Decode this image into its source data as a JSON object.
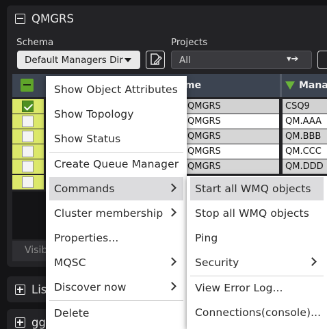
{
  "panel": {
    "title": "QMGRS"
  },
  "schema": {
    "label": "Schema",
    "value": "Default Managers Dir"
  },
  "projects": {
    "label": "Projects",
    "value": "All"
  },
  "table": {
    "columns": [
      "me",
      "Mana"
    ],
    "rows": [
      {
        "checked": true,
        "name": "QMGRS",
        "manager": "CSQ9"
      },
      {
        "checked": false,
        "name": "QMGRS",
        "manager": "QM.AAA"
      },
      {
        "checked": false,
        "name": "QMGRS",
        "manager": "QM.BBB"
      },
      {
        "checked": false,
        "name": "QMGRS",
        "manager": "QM.CCC"
      },
      {
        "checked": false,
        "name": "QMGRS",
        "manager": "QM.DDD"
      },
      {
        "checked": false,
        "name": "",
        "manager": ""
      }
    ],
    "footer": "Visib"
  },
  "lower_panels": [
    "Lis",
    "gg"
  ],
  "context_menu": {
    "items": [
      {
        "label": "Show Object Attributes",
        "submenu": false
      },
      {
        "label": "Show Topology",
        "submenu": false
      },
      {
        "label": "Show Status",
        "submenu": false
      },
      {
        "label": "Create Queue Manager",
        "submenu": false
      },
      {
        "label": "Commands",
        "submenu": true,
        "highlighted": true
      },
      {
        "label": "Cluster membership",
        "submenu": true
      },
      {
        "label": "Properties...",
        "submenu": false
      },
      {
        "label": "MQSC",
        "submenu": true
      },
      {
        "label": "Discover now",
        "submenu": true
      },
      {
        "label": "Delete",
        "submenu": false
      }
    ]
  },
  "commands_submenu": {
    "items": [
      {
        "label": "Start all WMQ objects",
        "submenu": false,
        "highlighted": true
      },
      {
        "label": "Stop all WMQ objects",
        "submenu": false
      },
      {
        "label": "Ping",
        "submenu": false
      },
      {
        "label": "Security",
        "submenu": true
      },
      {
        "label": "View Error Log...",
        "submenu": false
      },
      {
        "label": "Connections(console)...",
        "submenu": false
      }
    ]
  },
  "colors": {
    "accent_green": "#5fa52a",
    "row_highlight": "#dce86a",
    "header_bg": "#3c4451"
  }
}
